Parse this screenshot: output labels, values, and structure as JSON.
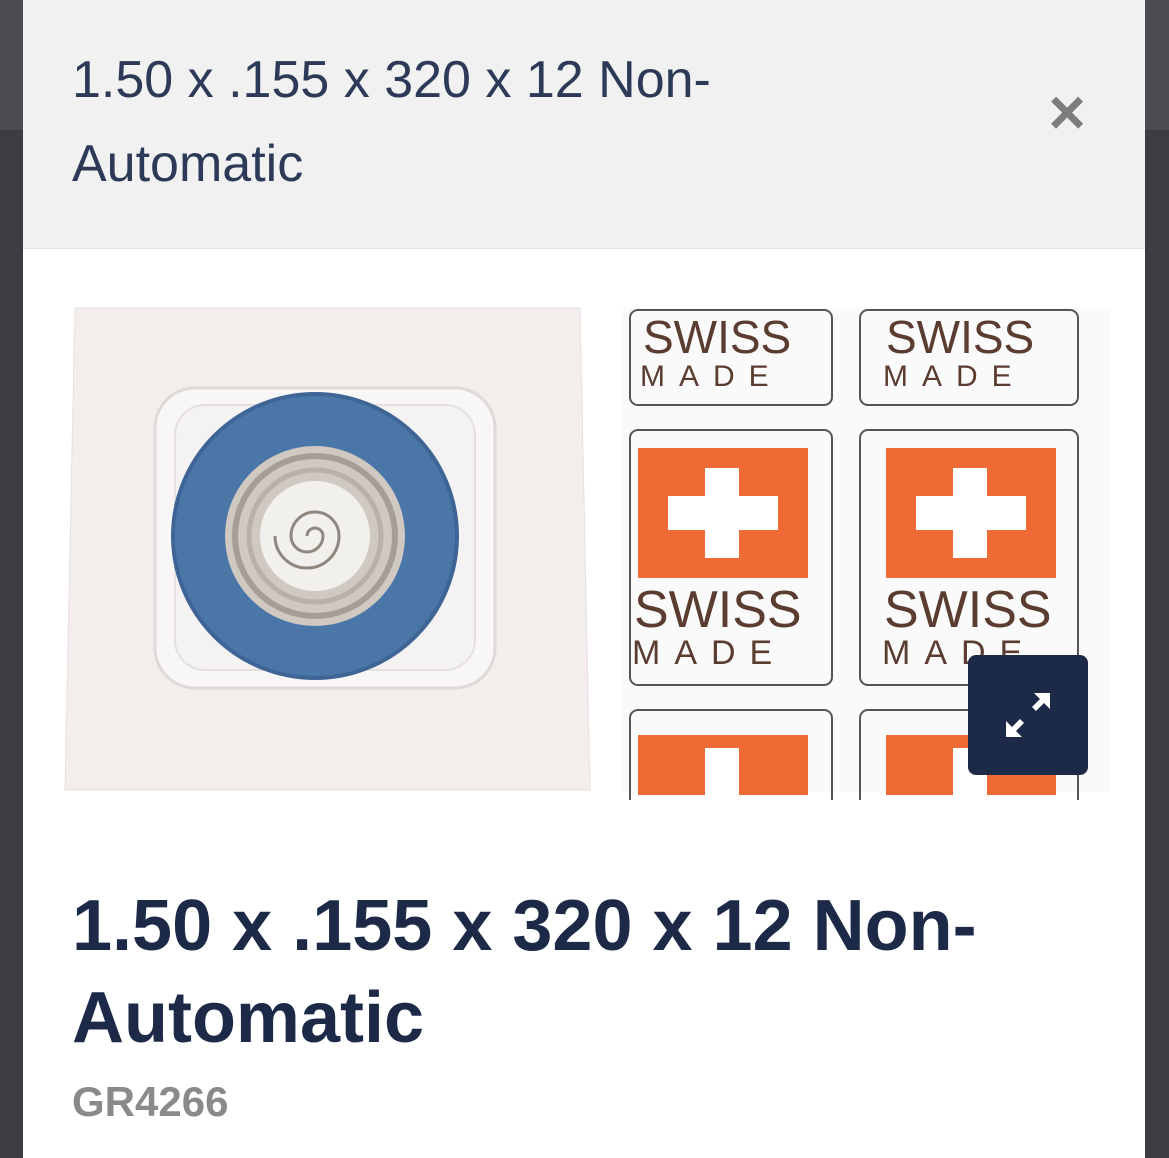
{
  "modal": {
    "title": "1.50 x .155 x 320 x 12 Non-Automatic",
    "close_label": "×"
  },
  "product": {
    "title": "1.50 x .155 x 320 x 12 Non-Automatic",
    "sku": "GR4266",
    "image": {
      "label_line1": "SWISS",
      "label_line2": "MADE",
      "flag_color": "#ef6a35",
      "spring_ring_color": "#4a76a8"
    }
  },
  "controls": {
    "expand_icon": "expand-arrows-icon",
    "close_icon": "close-icon"
  }
}
